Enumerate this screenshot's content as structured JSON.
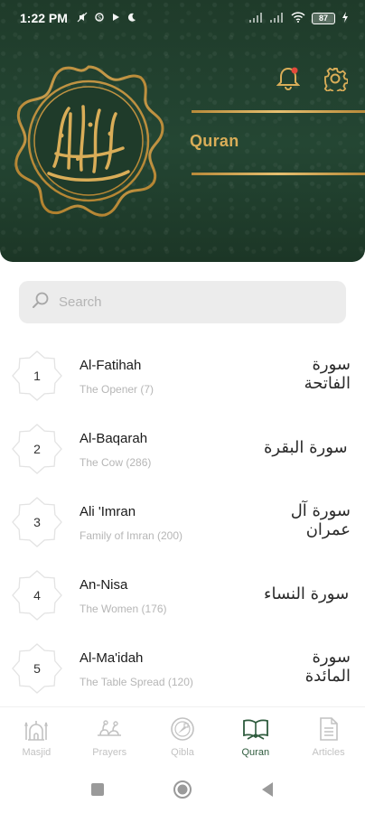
{
  "status_bar": {
    "time": "1:22 PM",
    "left_icons": [
      "mute-icon",
      "data-icon",
      "play-icon",
      "moon-icon"
    ],
    "battery": "87"
  },
  "header": {
    "title": "Quran",
    "emblem": "quran-calligraphy-medallion",
    "actions": [
      "notification-bell-icon",
      "settings-gear-icon"
    ],
    "colors": {
      "background": "#21402d",
      "gold": "#d9ad58"
    }
  },
  "search": {
    "placeholder": "Search",
    "value": ""
  },
  "surahs": [
    {
      "number": "1",
      "name": "Al-Fatihah",
      "subtitle": "The Opener (7)",
      "arabic": "سورة الفاتحة"
    },
    {
      "number": "2",
      "name": "Al-Baqarah",
      "subtitle": "The Cow (286)",
      "arabic": "سورة البقرة"
    },
    {
      "number": "3",
      "name": "Ali 'Imran",
      "subtitle": "Family of Imran (200)",
      "arabic": "سورة آل عمران"
    },
    {
      "number": "4",
      "name": "An-Nisa",
      "subtitle": "The Women (176)",
      "arabic": "سورة النساء"
    },
    {
      "number": "5",
      "name": "Al-Ma'idah",
      "subtitle": "The Table Spread (120)",
      "arabic": "سورة المائدة"
    }
  ],
  "bottom_nav": {
    "items": [
      {
        "label": "Masjid",
        "icon": "mosque-icon",
        "active": false
      },
      {
        "label": "Prayers",
        "icon": "prayer-icon",
        "active": false
      },
      {
        "label": "Qibla",
        "icon": "compass-icon",
        "active": false
      },
      {
        "label": "Quran",
        "icon": "quran-book-icon",
        "active": true
      },
      {
        "label": "Articles",
        "icon": "document-icon",
        "active": false
      }
    ],
    "active_color": "#2e5b3d",
    "inactive_color": "#c2c2c2"
  },
  "system_nav": [
    "recents-icon",
    "home-icon",
    "back-icon"
  ]
}
